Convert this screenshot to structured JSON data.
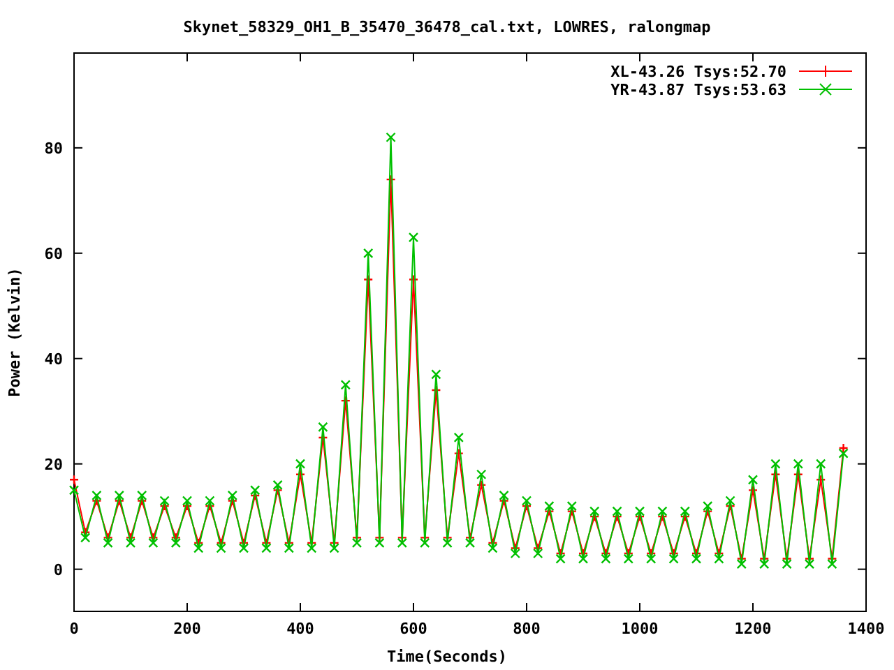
{
  "chart_data": {
    "type": "line",
    "title": "Skynet_58329_OH1_B_35470_36478_cal.txt, LOWRES, ralongmap",
    "xlabel": "Time(Seconds)",
    "ylabel": "Power (Kelvin)",
    "x": [
      0,
      20,
      40,
      60,
      80,
      100,
      120,
      140,
      160,
      180,
      200,
      220,
      240,
      260,
      280,
      300,
      320,
      340,
      360,
      380,
      400,
      420,
      440,
      460,
      480,
      500,
      520,
      540,
      560,
      580,
      600,
      620,
      640,
      660,
      680,
      700,
      720,
      740,
      760,
      780,
      800,
      820,
      840,
      860,
      880,
      900,
      920,
      940,
      960,
      980,
      1000,
      1020,
      1040,
      1060,
      1080,
      1100,
      1120,
      1140,
      1160,
      1180,
      1200,
      1220,
      1240,
      1260,
      1280,
      1300,
      1320,
      1340,
      1360
    ],
    "series": [
      {
        "name": "XL-43.26 Tsys:52.70",
        "color": "#ff0000",
        "marker": "plus",
        "values": [
          17,
          7,
          13,
          6,
          13,
          6,
          13,
          6,
          12,
          6,
          12,
          5,
          12,
          5,
          13,
          5,
          14,
          5,
          15,
          5,
          18,
          5,
          25,
          5,
          32,
          6,
          55,
          6,
          74,
          6,
          55,
          6,
          34,
          6,
          22,
          6,
          16,
          5,
          13,
          4,
          12,
          4,
          11,
          3,
          11,
          3,
          10,
          3,
          10,
          3,
          10,
          3,
          10,
          3,
          10,
          3,
          11,
          3,
          12,
          2,
          15,
          2,
          18,
          2,
          18,
          2,
          17,
          2,
          23
        ]
      },
      {
        "name": "YR-43.87 Tsys:53.63",
        "color": "#00c000",
        "marker": "cross",
        "values": [
          15,
          6,
          14,
          5,
          14,
          5,
          14,
          5,
          13,
          5,
          13,
          4,
          13,
          4,
          14,
          4,
          15,
          4,
          16,
          4,
          20,
          4,
          27,
          4,
          35,
          5,
          60,
          5,
          82,
          5,
          63,
          5,
          37,
          5,
          25,
          5,
          18,
          4,
          14,
          3,
          13,
          3,
          12,
          2,
          12,
          2,
          11,
          2,
          11,
          2,
          11,
          2,
          11,
          2,
          11,
          2,
          12,
          2,
          13,
          1,
          17,
          1,
          20,
          1,
          20,
          1,
          20,
          1,
          22
        ]
      }
    ],
    "xlim": [
      0,
      1400
    ],
    "ylim": [
      -8,
      98
    ],
    "xticks": [
      0,
      200,
      400,
      600,
      800,
      1000,
      1200,
      1400
    ],
    "yticks": [
      0,
      20,
      40,
      60,
      80
    ],
    "legend": true
  }
}
